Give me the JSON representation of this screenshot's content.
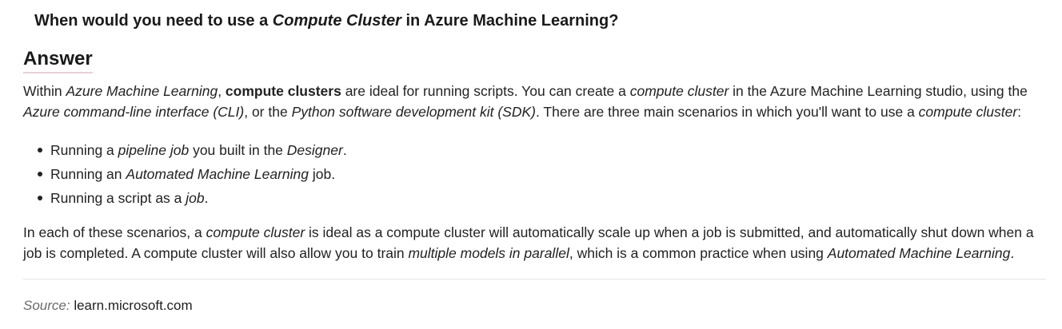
{
  "question": {
    "pre": "When would you need to use a ",
    "em": "Compute Cluster",
    "post": " in Azure Machine Learning?"
  },
  "answer_heading": "Answer",
  "paragraph1": {
    "s1": "Within ",
    "s2": "Azure Machine Learning",
    "s3": ", ",
    "s4": "compute clusters",
    "s5": " are ideal for running scripts. You can create a ",
    "s6": "compute cluster",
    "s7": " in the Azure Machine Learning studio, using the ",
    "s8": "Azure command-line interface (CLI)",
    "s9": ", or the ",
    "s10": "Python software development kit (SDK)",
    "s11": ". There are three main scenarios in which you'll want to use a ",
    "s12": "compute cluster",
    "s13": ":"
  },
  "bullets": [
    {
      "a": "Running a ",
      "b": "pipeline job",
      "c": " you built in the ",
      "d": "Designer",
      "e": "."
    },
    {
      "a": "Running an ",
      "b": "Automated Machine Learning",
      "c": " job."
    },
    {
      "a": "Running a script as a ",
      "b": "job",
      "c": "."
    }
  ],
  "paragraph2": {
    "s1": "In each of these scenarios, a ",
    "s2": "compute cluster",
    "s3": " is ideal as a compute cluster will automatically scale up when a job is submitted, and automatically shut down when a job is completed. A compute cluster will also allow you to train ",
    "s4": "multiple models in parallel",
    "s5": ", which is a common practice when using ",
    "s6": "Automated Machine Learning",
    "s7": "."
  },
  "source": {
    "label": "Source:",
    "value": "learn.microsoft.com"
  }
}
